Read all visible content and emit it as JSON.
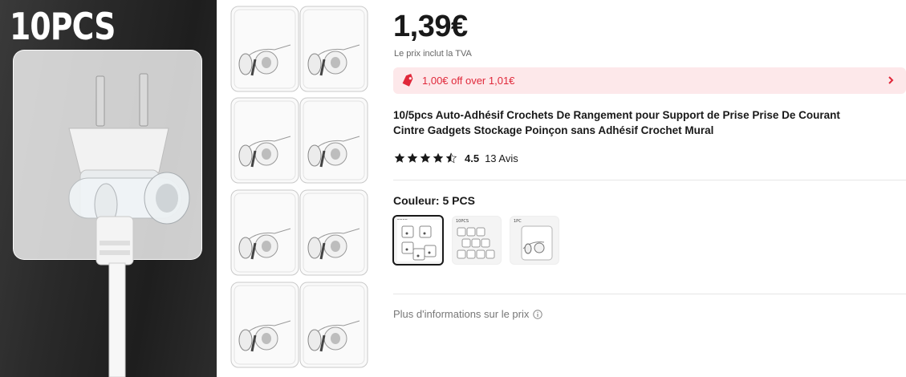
{
  "image": {
    "badge": "10PCS"
  },
  "price": {
    "amount": "1,39€",
    "vat_note": "Le prix inclut la TVA"
  },
  "coupon": {
    "text": "1,00€ off over 1,01€",
    "icon": "tag-icon",
    "accent_color": "#e0283a",
    "background_color": "#fde8ea"
  },
  "product": {
    "title_line1": "10/5pcs Auto-Adhésif Crochets De Rangement pour Support de Prise Prise De Courant",
    "title_line2": "Cintre Gadgets Stockage Poinçon sans Adhésif Crochet Mural"
  },
  "rating": {
    "stars": 4.5,
    "value": "4.5",
    "reviews": "13 Avis"
  },
  "color": {
    "label": "Couleur: 5 PCS",
    "options": [
      {
        "label": "5PCS",
        "selected": true
      },
      {
        "label": "10PCS",
        "selected": false
      },
      {
        "label": "1PC",
        "selected": false
      }
    ]
  },
  "footer": {
    "price_info": "Plus d'informations sur le prix",
    "icon": "info-icon"
  }
}
